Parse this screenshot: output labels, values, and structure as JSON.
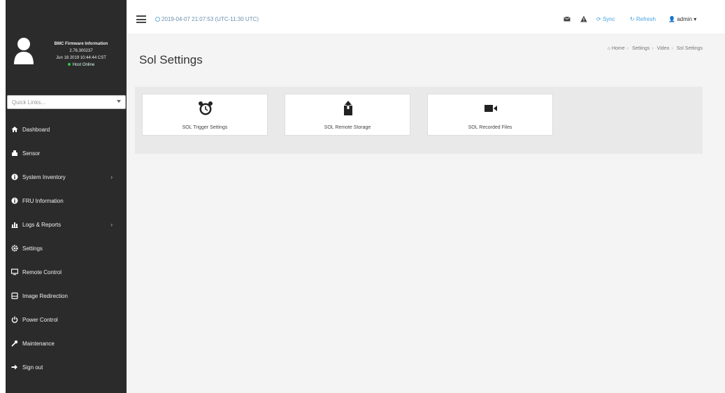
{
  "sidebar": {
    "firmware": {
      "title": "BMC Firmware Information",
      "version": "2.76.300237",
      "build_date": "Jun 18 2019 10:44:44 CST",
      "status": "Host Online"
    },
    "quick_links_placeholder": "Quick Links...",
    "items": [
      {
        "label": "Dashboard",
        "icon": "dashboard-icon"
      },
      {
        "label": "Sensor",
        "icon": "sensor-icon"
      },
      {
        "label": "System Inventory",
        "icon": "info-icon",
        "has_submenu": true
      },
      {
        "label": "FRU Information",
        "icon": "info-icon"
      },
      {
        "label": "Logs & Reports",
        "icon": "chart-icon",
        "has_submenu": true
      },
      {
        "label": "Settings",
        "icon": "gear-icon"
      },
      {
        "label": "Remote Control",
        "icon": "monitor-icon"
      },
      {
        "label": "Image Redirection",
        "icon": "disk-icon"
      },
      {
        "label": "Power Control",
        "icon": "power-icon"
      },
      {
        "label": "Maintenance",
        "icon": "wrench-icon"
      },
      {
        "label": "Sign out",
        "icon": "sign-out-icon"
      }
    ]
  },
  "topbar": {
    "datetime": "2019-04-07 21:07:53 (UTC-11:30 UTC)",
    "sync_label": "Sync",
    "refresh_label": "Refresh",
    "user_label": "admin"
  },
  "page": {
    "title": "Sol Settings",
    "breadcrumb": [
      "Home",
      "Settings",
      "Video",
      "Sol Settings"
    ]
  },
  "cards": [
    {
      "label": "SOL Trigger Settings",
      "icon": "alarm-clock-icon"
    },
    {
      "label": "SOL Remote Storage",
      "icon": "upload-icon"
    },
    {
      "label": "SOL Recorded Files",
      "icon": "video-camera-icon"
    }
  ],
  "colors": {
    "sidebar_bg": "#2b2b2b",
    "accent": "#4aa3df",
    "online": "#2ecc40"
  }
}
